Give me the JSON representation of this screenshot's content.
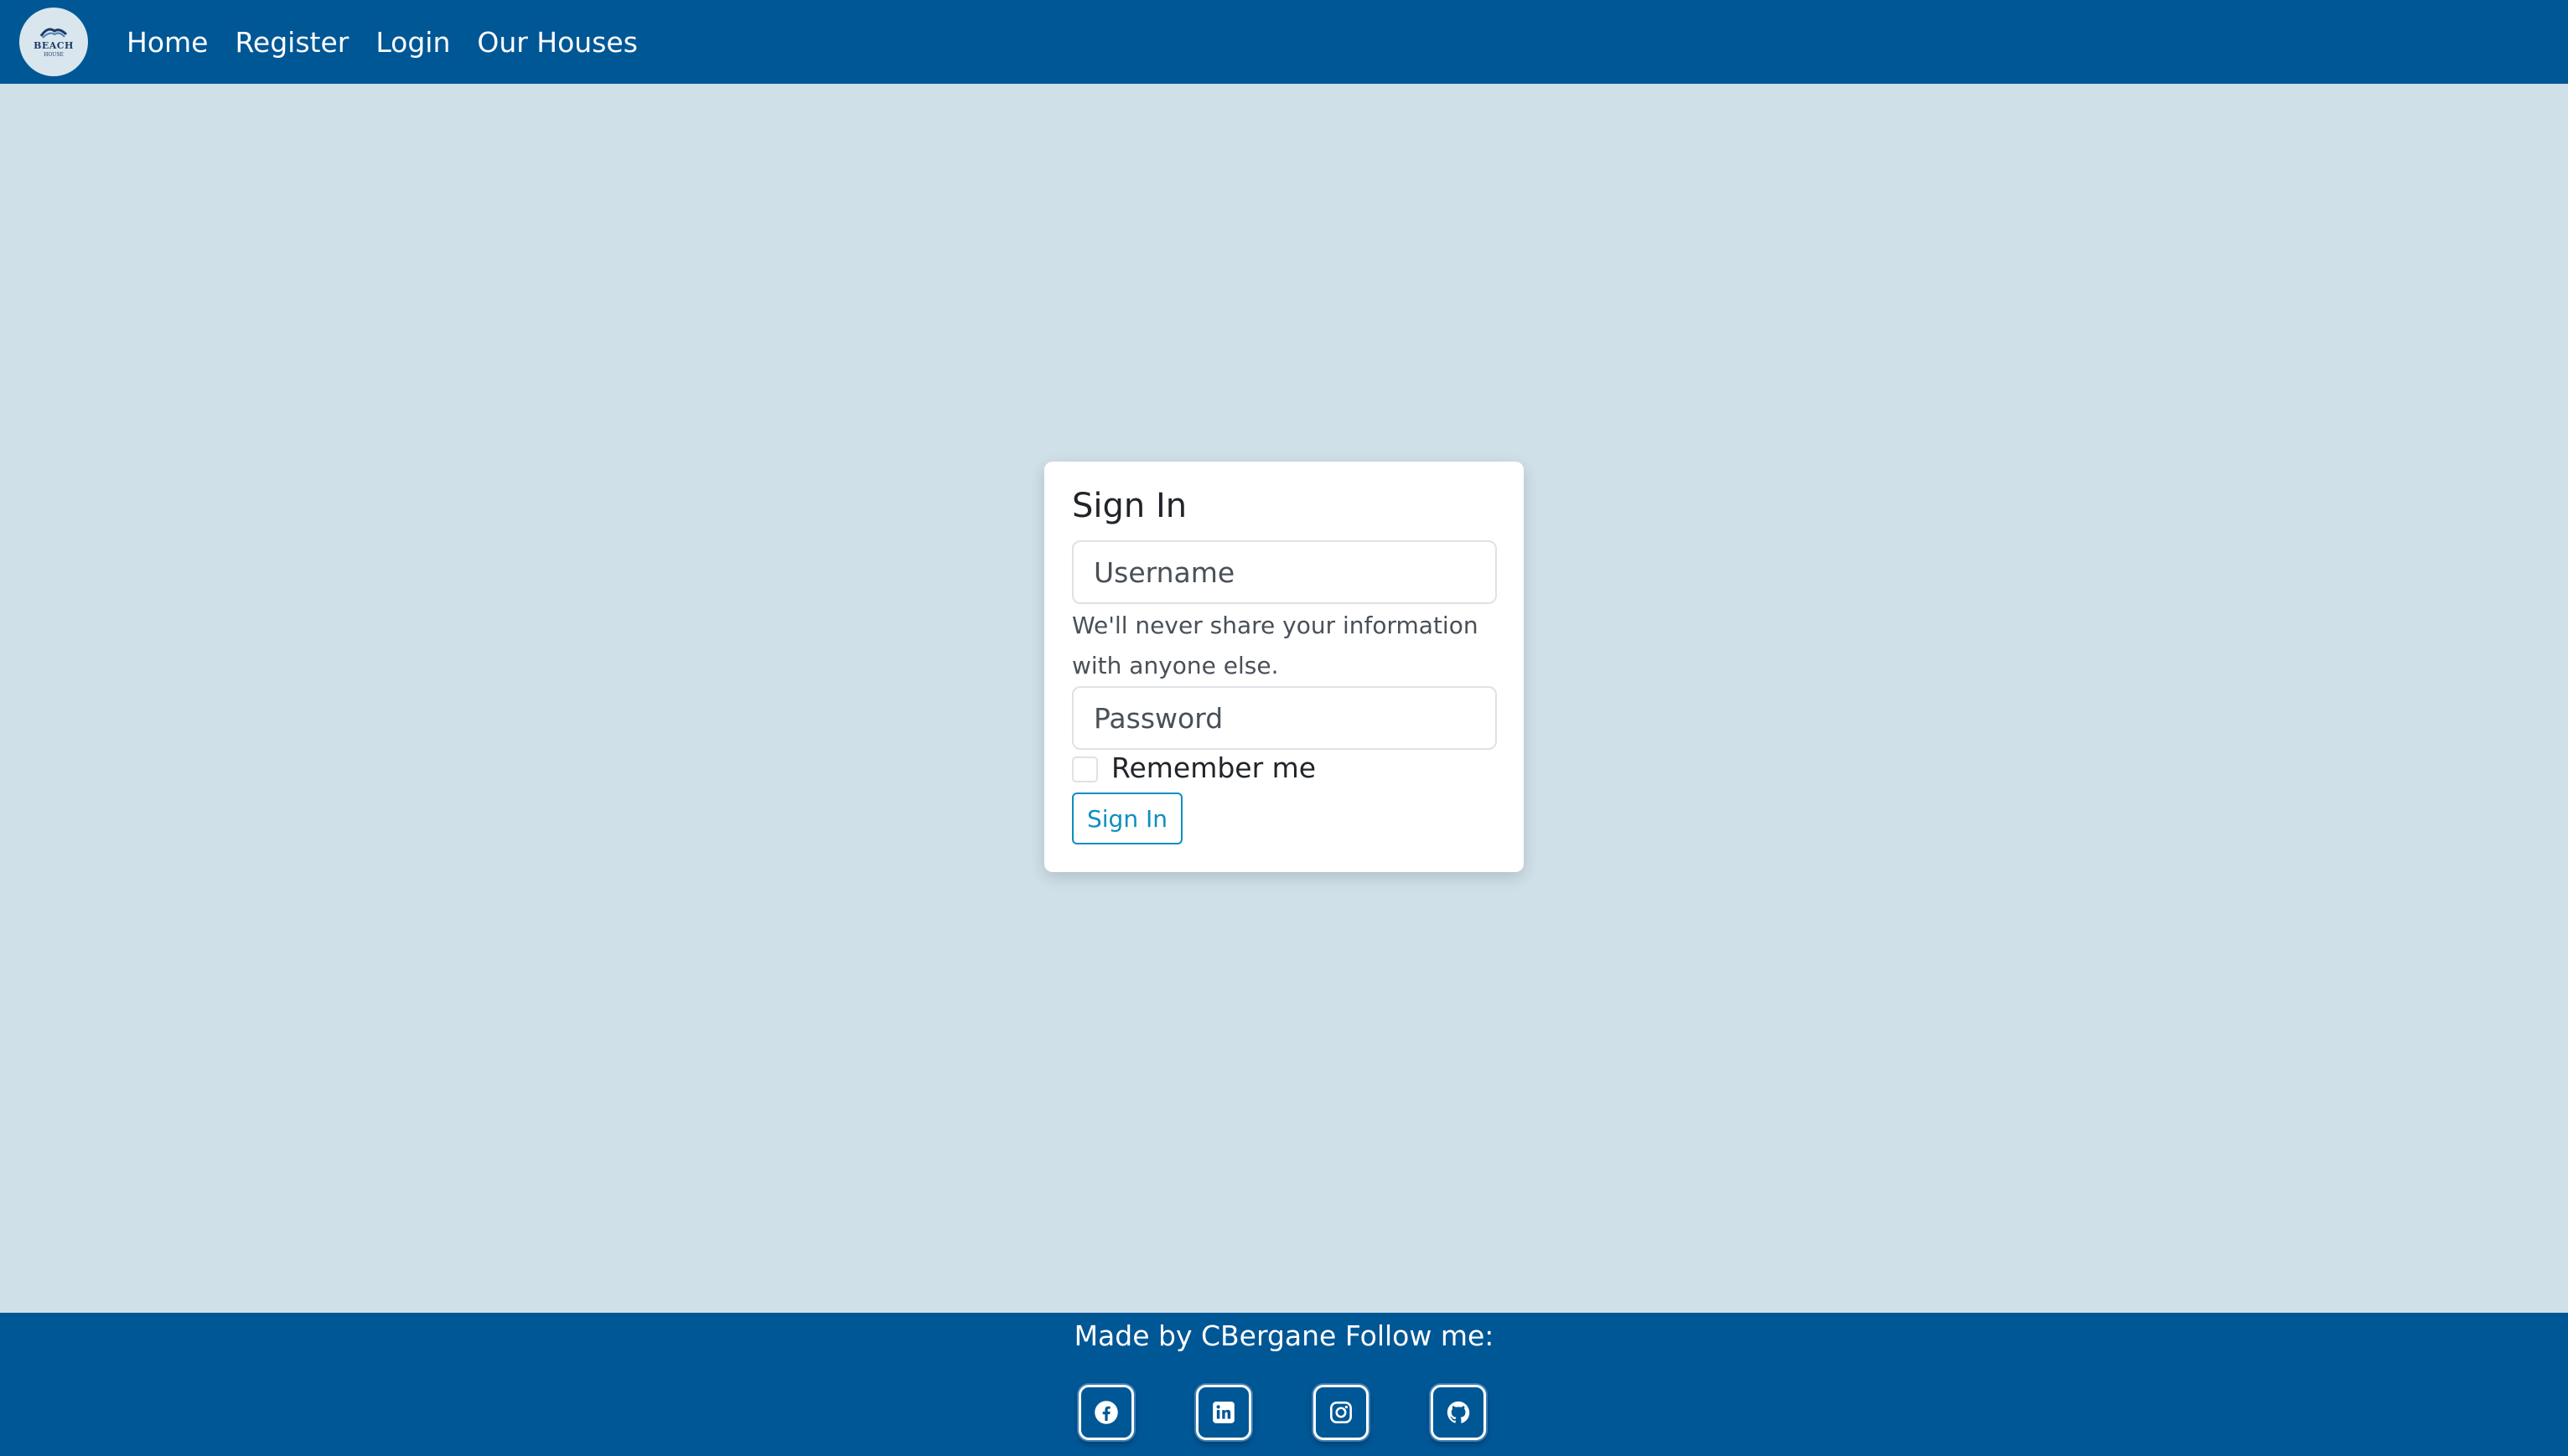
{
  "nav": {
    "logo": {
      "text": "BEACH",
      "sub": "HOUSE"
    },
    "links": [
      "Home",
      "Register",
      "Login",
      "Our Houses"
    ]
  },
  "signin": {
    "title": "Sign In",
    "username_placeholder": "Username",
    "help_text": "We'll never share your information with anyone else.",
    "password_placeholder": "Password",
    "remember_label": "Remember me",
    "submit_label": "Sign In"
  },
  "footer": {
    "text": "Made by CBergane Follow me:",
    "social": [
      "facebook-icon",
      "linkedin-icon",
      "instagram-icon",
      "github-icon"
    ]
  },
  "colors": {
    "brand": "#005796",
    "background": "#cfe0e8",
    "button_outline": "#0d8ec0"
  }
}
